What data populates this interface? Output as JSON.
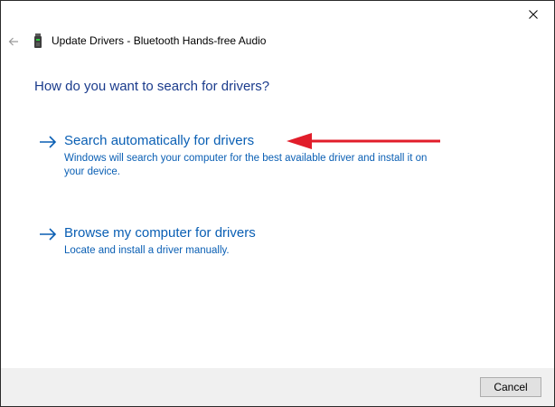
{
  "window": {
    "close_icon": "close-icon",
    "back_icon": "back-arrow-icon",
    "device_icon": "bluetooth-audio-device-icon"
  },
  "dialog": {
    "title": "Update Drivers - Bluetooth Hands-free Audio",
    "heading": "How do you want to search for drivers?"
  },
  "options": [
    {
      "title": "Search automatically for drivers",
      "description_line1": "Windows will search your computer for the best available driver and install it on",
      "description_line2": "your device.",
      "icon": "right-arrow-icon"
    },
    {
      "title": "Browse my computer for drivers",
      "description_line1": "Locate and install a driver manually.",
      "icon": "right-arrow-icon"
    }
  ],
  "annotation": {
    "type": "red-pointer-arrow",
    "color": "#e11d2a"
  },
  "footer": {
    "cancel_label": "Cancel"
  },
  "colors": {
    "link": "#0a5fb4",
    "heading": "#1a3b8c",
    "footer_bg": "#f0f0f0"
  }
}
